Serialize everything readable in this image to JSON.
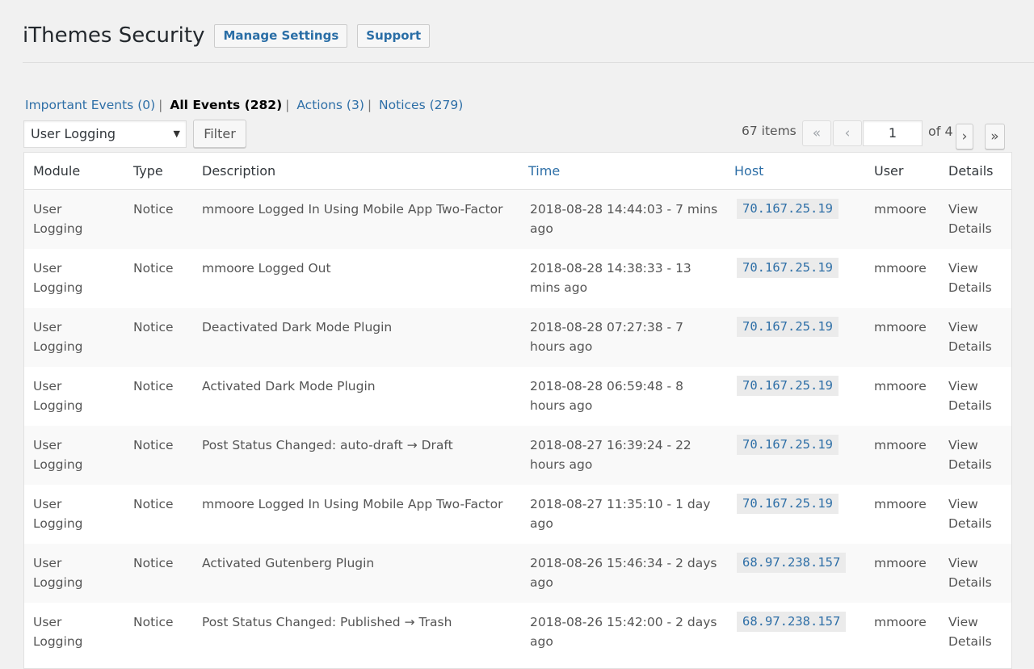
{
  "header": {
    "title": "iThemes Security",
    "manage_settings_label": "Manage Settings",
    "support_label": "Support"
  },
  "views": [
    {
      "label": "Important Events",
      "count": "(0)",
      "current": false
    },
    {
      "label": "All Events",
      "count": "(282)",
      "current": true
    },
    {
      "label": "Actions",
      "count": "(3)",
      "current": false
    },
    {
      "label": "Notices",
      "count": "(279)",
      "current": false
    }
  ],
  "filter": {
    "selected_module": "User Logging",
    "button_label": "Filter"
  },
  "pagination": {
    "items_count": "67 items",
    "first": "«",
    "prev": "‹",
    "current_page": "1",
    "of_label": "of 4",
    "next": "›",
    "last": "»"
  },
  "table": {
    "columns": [
      "Module",
      "Type",
      "Description",
      "Time",
      "Host",
      "User",
      "Details"
    ],
    "rows": [
      {
        "module": "User Logging",
        "type": "Notice",
        "description": "mmoore Logged In Using Mobile App Two-Factor",
        "time": "2018-08-28 14:44:03 - 7 mins ago",
        "host": "70.167.25.19",
        "user": "mmoore",
        "details": "View Details"
      },
      {
        "module": "User Logging",
        "type": "Notice",
        "description": "mmoore Logged Out",
        "time": "2018-08-28 14:38:33 - 13 mins ago",
        "host": "70.167.25.19",
        "user": "mmoore",
        "details": "View Details"
      },
      {
        "module": "User Logging",
        "type": "Notice",
        "description": "Deactivated Dark Mode Plugin",
        "time": "2018-08-28 07:27:38 - 7 hours ago",
        "host": "70.167.25.19",
        "user": "mmoore",
        "details": "View Details"
      },
      {
        "module": "User Logging",
        "type": "Notice",
        "description": "Activated Dark Mode Plugin",
        "time": "2018-08-28 06:59:48 - 8 hours ago",
        "host": "70.167.25.19",
        "user": "mmoore",
        "details": "View Details"
      },
      {
        "module": "User Logging",
        "type": "Notice",
        "description": "Post Status Changed: auto-draft → Draft",
        "time": "2018-08-27 16:39:24 - 22 hours ago",
        "host": "70.167.25.19",
        "user": "mmoore",
        "details": "View Details"
      },
      {
        "module": "User Logging",
        "type": "Notice",
        "description": "mmoore Logged In Using Mobile App Two-Factor",
        "time": "2018-08-27 11:35:10 - 1 day ago",
        "host": "70.167.25.19",
        "user": "mmoore",
        "details": "View Details"
      },
      {
        "module": "User Logging",
        "type": "Notice",
        "description": "Activated Gutenberg Plugin",
        "time": "2018-08-26 15:46:34 - 2 days ago",
        "host": "68.97.238.157",
        "user": "mmoore",
        "details": "View Details"
      },
      {
        "module": "User Logging",
        "type": "Notice",
        "description": "Post Status Changed: Published → Trash",
        "time": "2018-08-26 15:42:00 - 2 days ago",
        "host": "68.97.238.157",
        "user": "mmoore",
        "details": "View Details"
      }
    ]
  }
}
